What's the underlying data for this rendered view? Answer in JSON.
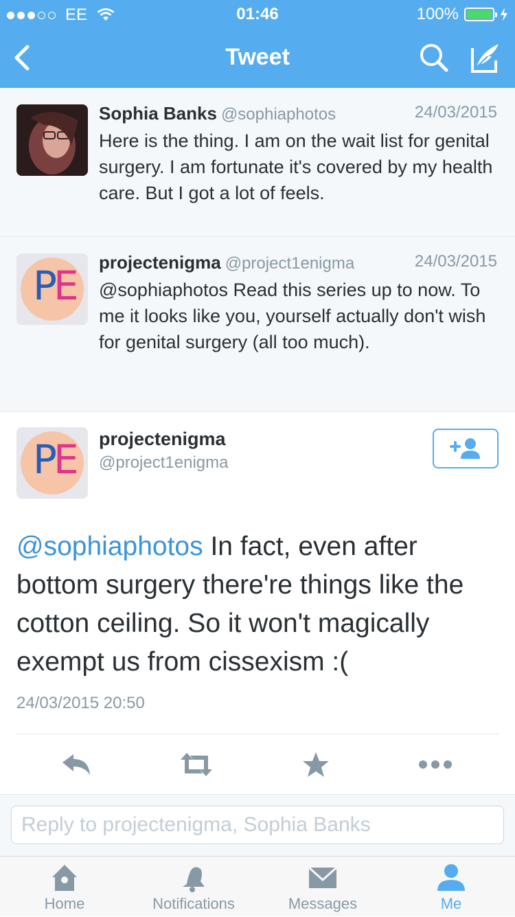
{
  "status_bar": {
    "carrier": "EE",
    "time": "01:46",
    "battery": "100%",
    "signal_bars_full": 3,
    "signal_bars_total": 5,
    "battery_level": 1.0
  },
  "nav": {
    "title": "Tweet",
    "icons": [
      "back-chevron-icon",
      "search-icon",
      "compose-icon"
    ]
  },
  "thread": [
    {
      "name": "Sophia Banks",
      "handle": "@sophiaphotos",
      "date": "24/03/2015",
      "text": "Here is the thing. I am on the wait list for genital surgery. I am fortunate it's covered by my health care. But I got a lot of feels."
    },
    {
      "name": "projectenigma",
      "handle": "@project1enigma",
      "date": "24/03/2015",
      "text": "@sophiaphotos Read this series up to now. To me it looks like you, yourself actually don't wish for genital surgery (all too much)."
    }
  ],
  "main_tweet": {
    "name": "projectenigma",
    "handle": "@project1enigma",
    "mention": "@sophiaphotos",
    "text": " In fact, even after bottom surgery there're things like the cotton ceiling. So it won't magically exempt us from cissexism :(",
    "timestamp": "24/03/2015 20:50",
    "avatar_letters": {
      "p": "P",
      "e": "E"
    }
  },
  "reply": {
    "placeholder": "Reply to projectenigma, Sophia Banks"
  },
  "tab_bar": {
    "items": [
      {
        "label": "Home",
        "icon": "home-icon"
      },
      {
        "label": "Notifications",
        "icon": "bell-icon"
      },
      {
        "label": "Messages",
        "icon": "envelope-icon"
      },
      {
        "label": "Me",
        "icon": "person-icon"
      }
    ],
    "active": "Me"
  },
  "colors": {
    "accent": "#55acee",
    "mention": "#3b94d9",
    "secondary_text": "#8899a6",
    "battery_fill": "#4cd964"
  }
}
